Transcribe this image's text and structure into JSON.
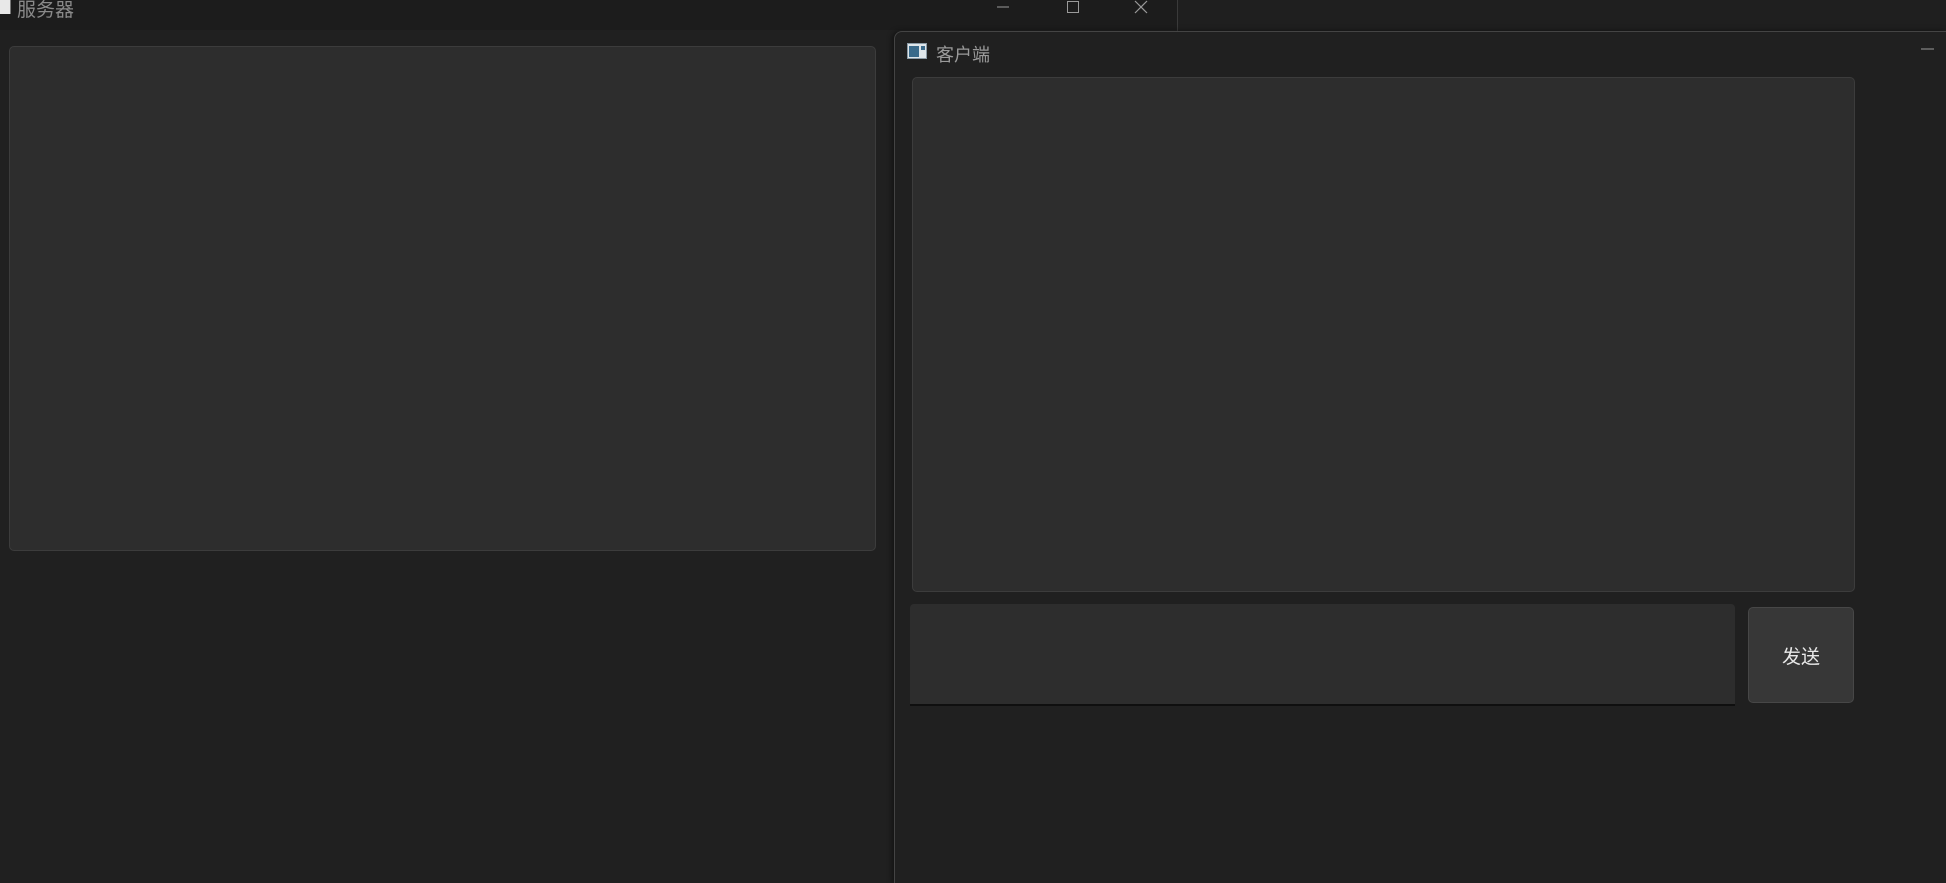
{
  "server_window": {
    "title": "服务器",
    "log_content": ""
  },
  "client_window": {
    "title": "客户端",
    "log_content": "",
    "input_value": "",
    "send_label": "发送"
  },
  "colors": {
    "background": "#1f1f1f",
    "panel": "#2d2d2d",
    "button": "#373737",
    "title_text": "#8a8a8a"
  },
  "icons": {
    "server_app": "app-window-icon",
    "client_app": "app-window-icon",
    "minimize": "minimize-icon",
    "maximize": "maximize-icon",
    "close": "close-icon"
  }
}
